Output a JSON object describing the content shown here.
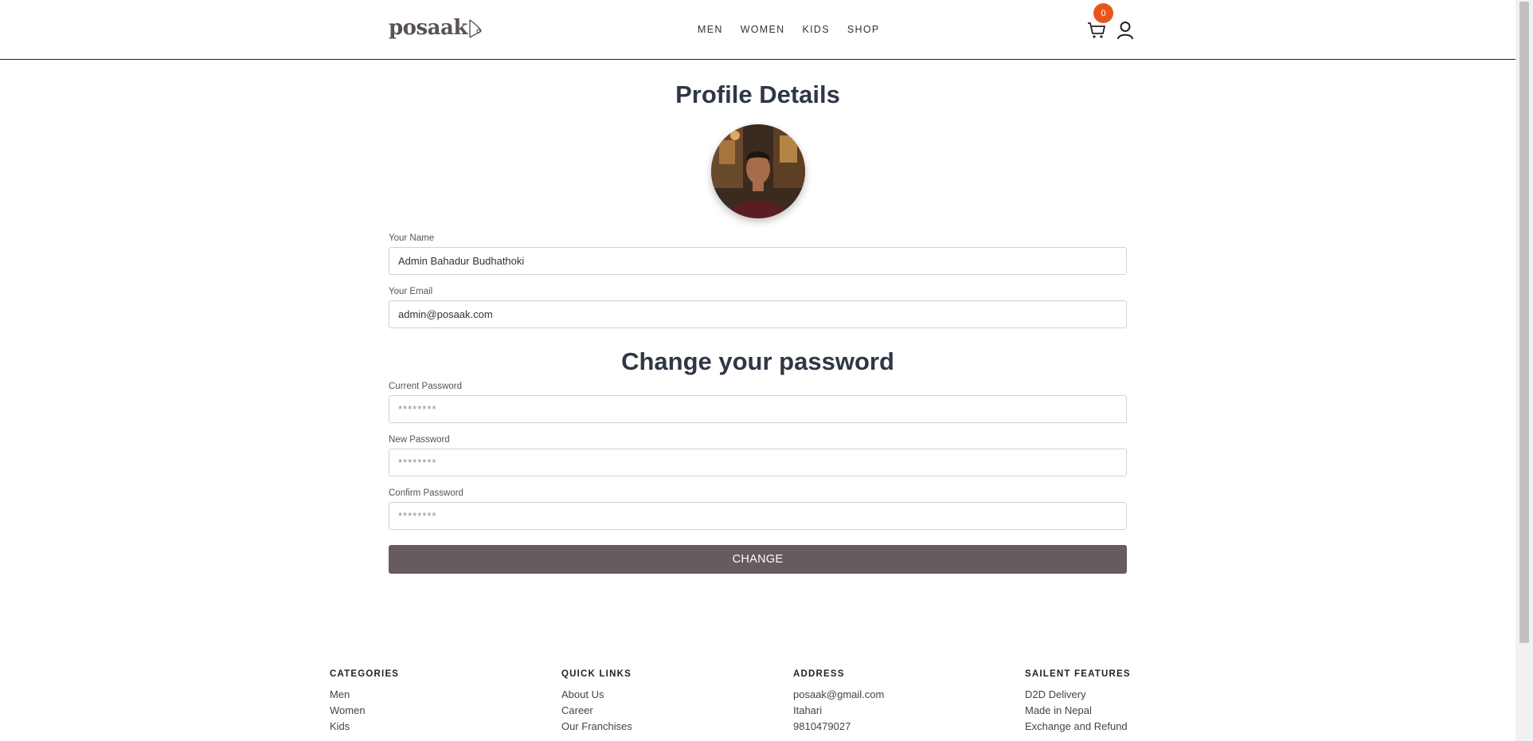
{
  "header": {
    "logo_text": "posaak",
    "nav": [
      "MEN",
      "WOMEN",
      "KIDS",
      "SHOP"
    ],
    "cart_count": "0",
    "accent_color": "#e8551b"
  },
  "main": {
    "title": "Profile Details",
    "name_label": "Your Name",
    "name_value": "Admin Bahadur Budhathoki",
    "email_label": "Your Email",
    "email_value": "admin@posaak.com",
    "password_title": "Change your password",
    "current_password_label": "Current Password",
    "current_password_placeholder": "********",
    "new_password_label": "New Password",
    "new_password_placeholder": "********",
    "confirm_password_label": "Confirm Password",
    "confirm_password_placeholder": "********",
    "change_button": "CHANGE",
    "button_color": "#675a60"
  },
  "footer": {
    "categories": {
      "title": "CATEGORIES",
      "items": [
        "Men",
        "Women",
        "Kids"
      ]
    },
    "quick_links": {
      "title": "QUICK LINKS",
      "items": [
        "About Us",
        "Career",
        "Our Franchises"
      ]
    },
    "address": {
      "title": "ADDRESS",
      "items": [
        "posaak@gmail.com",
        "Itahari",
        "9810479027"
      ]
    },
    "features": {
      "title": "SAILENT FEATURES",
      "items": [
        "D2D Delivery",
        "Made in Nepal",
        "Exchange and Refund"
      ]
    }
  }
}
